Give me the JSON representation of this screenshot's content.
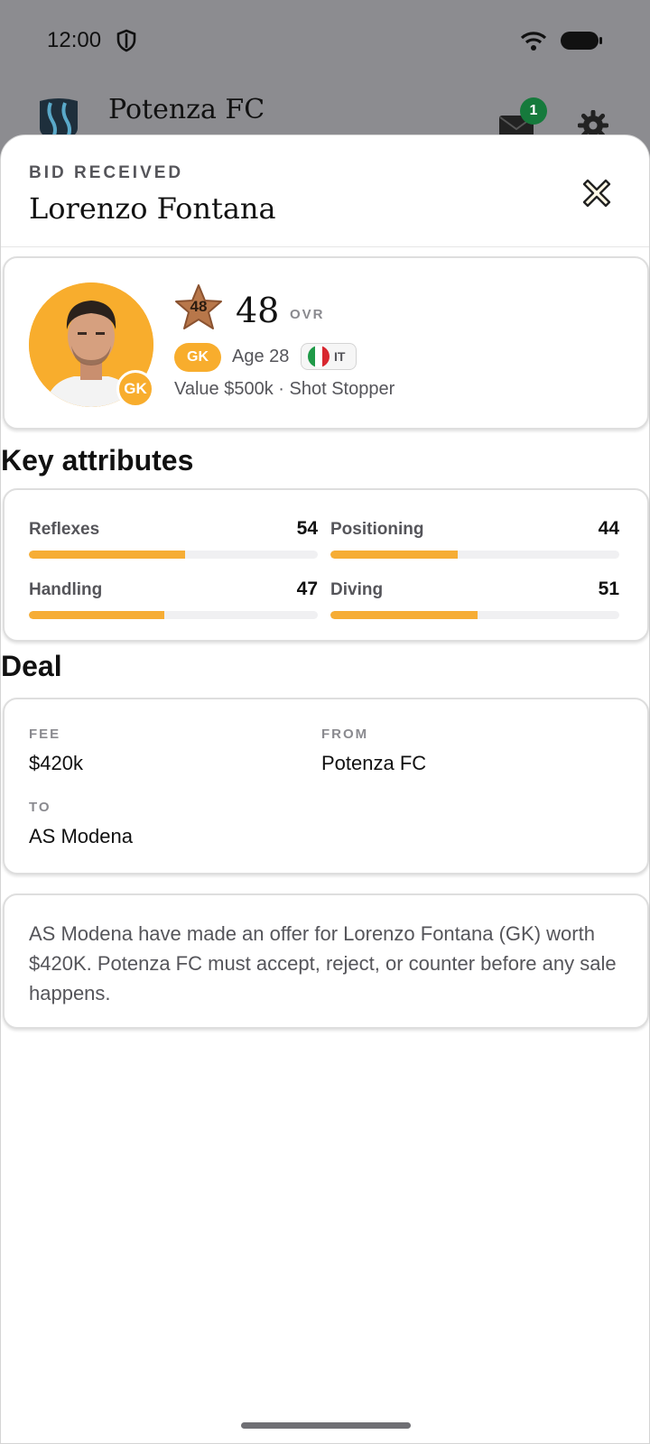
{
  "status_bar": {
    "time": "12:00"
  },
  "app_header": {
    "club_name": "Potenza FC",
    "notification_count": "1"
  },
  "sheet": {
    "eyebrow": "BID RECEIVED",
    "title": "Lorenzo Fontana"
  },
  "player": {
    "position_badge": "GK",
    "rating": "48",
    "ovr_value": "48",
    "ovr_label": "OVR",
    "position_chip": "GK",
    "age": "Age 28",
    "nationality_code": "IT",
    "value_line": "Value $500k · Shot Stopper"
  },
  "attributes": {
    "heading": "Key attributes",
    "items": [
      {
        "name": "Reflexes",
        "value": "54",
        "level": 0.54
      },
      {
        "name": "Positioning",
        "value": "44",
        "level": 0.44
      },
      {
        "name": "Handling",
        "value": "47",
        "level": 0.47
      },
      {
        "name": "Diving",
        "value": "51",
        "level": 0.51
      }
    ],
    "bar_color": "#f6ad35"
  },
  "deal": {
    "heading": "Deal",
    "fee_label": "FEE",
    "fee_value": "$420k",
    "from_label": "FROM",
    "from_value": "Potenza FC",
    "to_label": "TO",
    "to_value": "AS Modena"
  },
  "message": {
    "text": "AS Modena have made an offer for Lorenzo Fontana (GK) worth $420K. Potenza FC must accept, reject, or counter before any sale happens."
  },
  "icons": {
    "status": [
      "shield-icon",
      "wifi-icon",
      "battery-icon"
    ],
    "header": [
      "club-crest-icon",
      "mail-icon",
      "gear-icon"
    ],
    "sheet": [
      "close-icon",
      "rating-star-icon",
      "italy-flag-icon"
    ]
  },
  "colors": {
    "accent": "#f8ad2d",
    "notification_badge": "#167a3c",
    "muted_text": "#55555a"
  }
}
